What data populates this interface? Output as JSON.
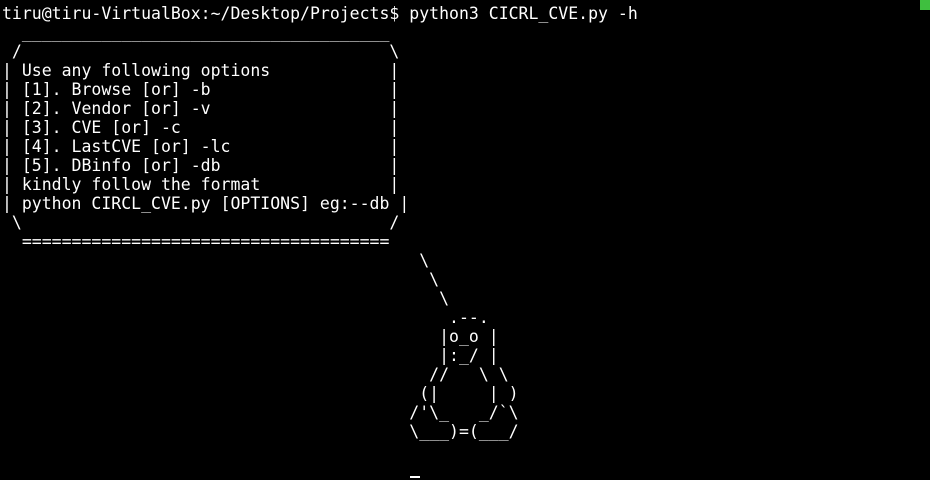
{
  "terminal": {
    "lines": [
      "tiru@tiru-VirtualBox:~/Desktop/Projects$ python3 CICRL_CVE.py -h",
      "  _____________________________________",
      " /                                     \\",
      "| Use any following options            |",
      "| [1]. Browse [or] -b                  |",
      "| [2]. Vendor [or] -v                  |",
      "| [3]. CVE [or] -c                     |",
      "| [4]. LastCVE [or] -lc                |",
      "| [5]. DBinfo [or] -db                 |",
      "| kindly follow the format             |",
      "| python CIRCL_CVE.py [OPTIONS] eg:--db |",
      " \\                                     /",
      "  =====================================",
      "                                          \\",
      "                                           \\",
      "                                            \\",
      "                                             .--.",
      "                                            |o_o |",
      "                                            |:_/ |",
      "                                           //   \\ \\",
      "                                          (|     | )",
      "                                         /'\\_   _/`\\",
      "                                         \\___)=(___/"
    ]
  },
  "colors": {
    "background": "#000000",
    "foreground": "#ffffff",
    "indicator": "#3fbf3f"
  }
}
